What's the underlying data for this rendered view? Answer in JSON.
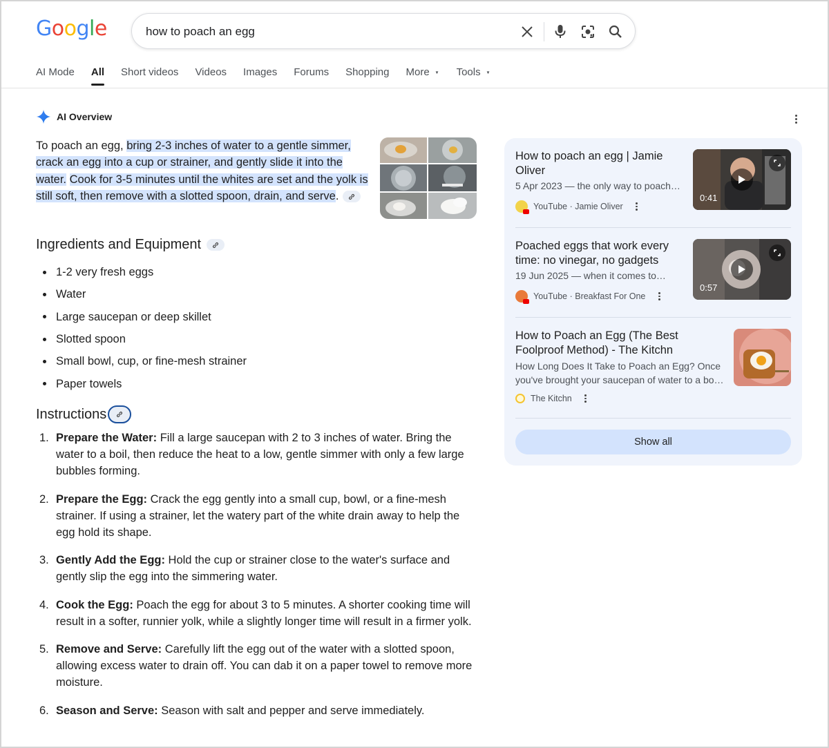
{
  "header": {
    "logo_letters": [
      {
        "ch": "G",
        "color": "#4285f4"
      },
      {
        "ch": "o",
        "color": "#ea4335"
      },
      {
        "ch": "o",
        "color": "#fbbc05"
      },
      {
        "ch": "g",
        "color": "#4285f4"
      },
      {
        "ch": "l",
        "color": "#34a853"
      },
      {
        "ch": "e",
        "color": "#ea4335"
      }
    ],
    "search_query": "how to poach an egg",
    "icons": [
      "clear-icon",
      "microphone-icon",
      "lens-camera-icon",
      "search-icon"
    ]
  },
  "tabs": [
    {
      "label": "AI Mode",
      "active": false
    },
    {
      "label": "All",
      "active": true
    },
    {
      "label": "Short videos",
      "active": false
    },
    {
      "label": "Videos",
      "active": false
    },
    {
      "label": "Images",
      "active": false
    },
    {
      "label": "Forums",
      "active": false
    },
    {
      "label": "Shopping",
      "active": false
    },
    {
      "label": "More",
      "active": false,
      "dropdown": true
    },
    {
      "label": "Tools",
      "active": false,
      "dropdown": true
    }
  ],
  "overview": {
    "title": "AI Overview",
    "intro_plain": "To poach an egg, ",
    "intro_hl1": "bring 2-3 inches of water to a gentle simmer, crack an egg into a cup or strainer, and gently slide it into the water.",
    "intro_hl2": "Cook for 3-5 minutes until the whites are set and the yolk is still soft, then remove with a slotted spoon, drain, and serve",
    "intro_end": ".",
    "ingredients_heading": "Ingredients and Equipment",
    "ingredients": [
      "1-2 very fresh eggs",
      "Water",
      "Large saucepan or deep skillet",
      "Slotted spoon",
      "Small bowl, cup, or fine-mesh strainer",
      "Paper towels"
    ],
    "instructions_heading": "Instructions",
    "steps": [
      {
        "num": "1.",
        "title": "Prepare the Water:",
        "text": " Fill a large saucepan with 2 to 3 inches of water. Bring the water to a boil, then reduce the heat to a low, gentle simmer with only a few large bubbles forming."
      },
      {
        "num": "2.",
        "title": "Prepare the Egg:",
        "text": " Crack the egg gently into a small cup, bowl, or a fine-mesh strainer. If using a strainer, let the watery part of the white drain away to help the egg hold its shape."
      },
      {
        "num": "3.",
        "title": "Gently Add the Egg:",
        "text": " Hold the cup or strainer close to the water's surface and gently slip the egg into the simmering water."
      },
      {
        "num": "4.",
        "title": "Cook the Egg:",
        "text": " Poach the egg for about 3 to 5 minutes. A shorter cooking time will result in a softer, runnier yolk, while a slightly longer time will result in a firmer yolk."
      },
      {
        "num": "5.",
        "title": "Remove and Serve:",
        "text": " Carefully lift the egg out of the water with a slotted spoon, allowing excess water to drain off. You can dab it on a paper towel to remove more moisture."
      },
      {
        "num": "6.",
        "title": "Season and Serve:",
        "text": " Season with salt and pepper and serve immediately."
      }
    ]
  },
  "sources": {
    "cards": [
      {
        "title": "How to poach an egg | Jamie Oliver",
        "snippet": "5 Apr 2023 — the only way to poach…",
        "source": "YouTube",
        "channel": "Jamie Oliver",
        "duration": "0:41"
      },
      {
        "title": "Poached eggs that work every time: no vinegar, no gadgets",
        "snippet": "19 Jun 2025 — when it comes to…",
        "source": "YouTube",
        "channel": "Breakfast For One",
        "duration": "0:57"
      },
      {
        "title": "How to Poach an Egg (The Best Foolproof Method) - The Kitchn",
        "snippet_line1": "How Long Does It Take to Poach an Egg? Once",
        "snippet_line2": "you've brought your saucepan of water to a bo…",
        "source": "The Kitchn"
      }
    ],
    "show_all": "Show all"
  },
  "colors": {
    "highlight": "#d3e3fd",
    "panel_bg": "#f0f4fc",
    "accent_blue": "#4285f4"
  }
}
